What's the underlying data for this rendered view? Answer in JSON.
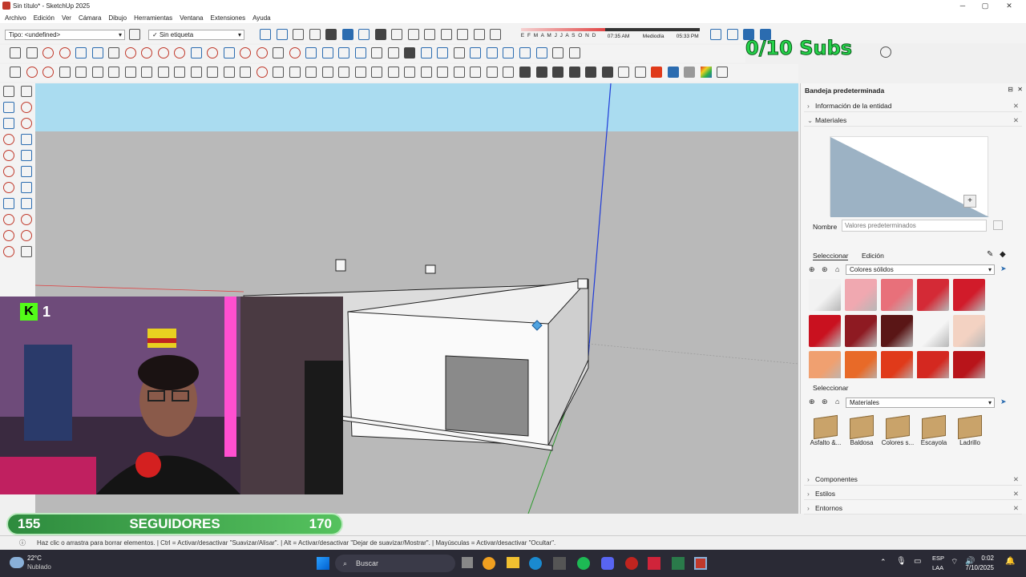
{
  "window": {
    "title": "Sin título* - SketchUp 2025"
  },
  "menu": [
    "Archivo",
    "Edición",
    "Ver",
    "Cámara",
    "Dibujo",
    "Herramientas",
    "Ventana",
    "Extensiones",
    "Ayuda"
  ],
  "toolbar": {
    "tipo_select": "Tipo: <undefined>",
    "tag_select": "Sin etiqueta",
    "shadow_months": "E F M A M J J A S O N D",
    "shadow_time_start": "07:35 AM",
    "shadow_midday": "Mediodía",
    "shadow_time_end": "05:33 PM"
  },
  "overlay": {
    "subs": "0/10 Subs",
    "followers_current": "155",
    "followers_label": "SEGUIDORES",
    "followers_goal": "170",
    "kick_badge": "1"
  },
  "tray": {
    "title": "Bandeja predeterminada",
    "entity_info": "Información de la entidad",
    "materials": "Materiales",
    "name_label": "Nombre",
    "name_placeholder": "Valores predeterminados",
    "tab_select": "Seleccionar",
    "tab_edit": "Edición",
    "library1": "Colores sólidos",
    "select2": "Seleccionar",
    "library2": "Materiales",
    "mat_items": [
      "Asfalto &...",
      "Baldosa",
      "Colores s...",
      "Escayola",
      "Ladrillo"
    ],
    "components": "Componentes",
    "styles": "Estilos",
    "environments": "Entornos",
    "swatch_colors": [
      "#f2f2f2",
      "#f0a8b0",
      "#e8707a",
      "#d42a36",
      "#d11b2a",
      "#c9111f",
      "#8e1a22",
      "#5a1616",
      "#f5f5f5",
      "#f3d2c2",
      "#f0a070",
      "#e86a28",
      "#e03a1a",
      "#d42820",
      "#b8141a"
    ]
  },
  "status": {
    "text": "Haz clic o arrastra para borrar elementos. | Ctrl = Activar/desactivar \"Suavizar/Alisar\". | Alt = Activar/desactivar \"Dejar de suavizar/Mostrar\". | Mayúsculas = Activar/desactivar \"Ocultar\"."
  },
  "taskbar": {
    "temp": "22°C",
    "weather": "Nublado",
    "search": "Buscar",
    "lang": "ESP",
    "layout": "LAA",
    "time": "0:02",
    "date": "7/10/2025"
  }
}
